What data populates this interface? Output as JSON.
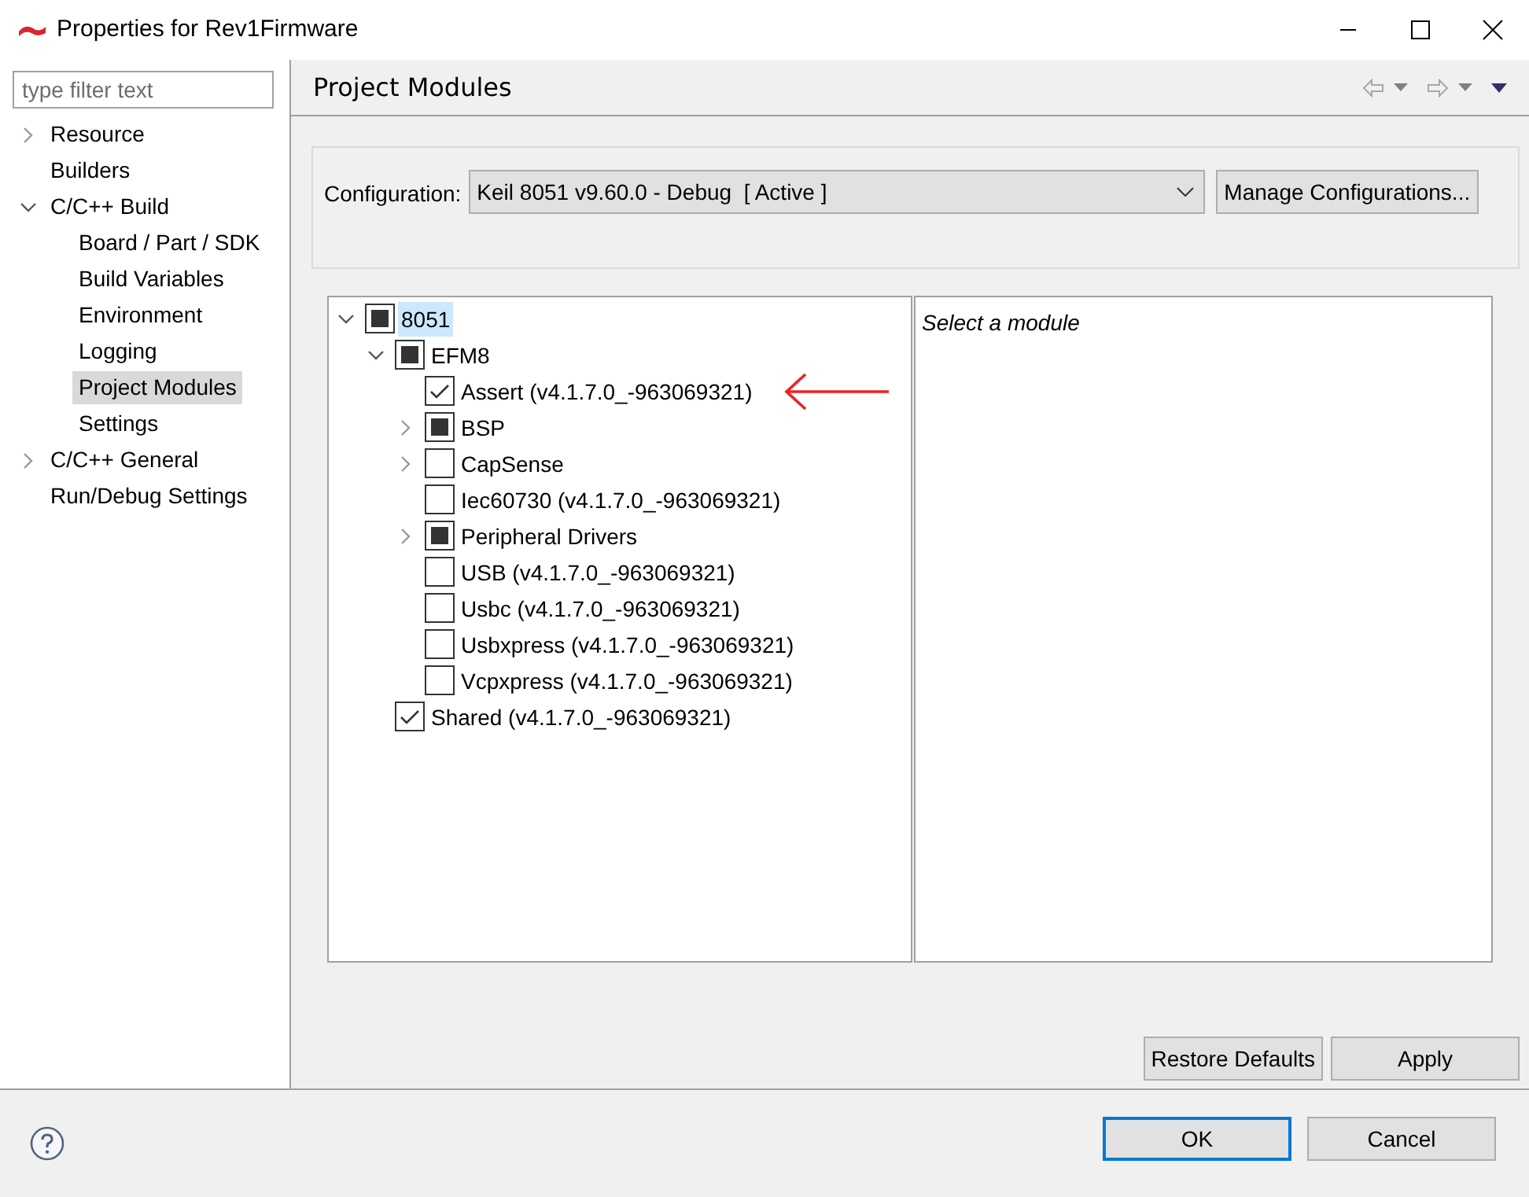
{
  "window": {
    "title": "Properties for Rev1Firmware"
  },
  "filter": {
    "placeholder": "type filter text"
  },
  "sidebar": {
    "items": [
      {
        "label": "Resource",
        "expanded": false,
        "selected": false
      },
      {
        "label": "Builders",
        "selected": false
      },
      {
        "label": "C/C++ Build",
        "expanded": true,
        "selected": false,
        "children": [
          {
            "label": "Board / Part / SDK",
            "selected": false
          },
          {
            "label": "Build Variables",
            "selected": false
          },
          {
            "label": "Environment",
            "selected": false
          },
          {
            "label": "Logging",
            "selected": false
          },
          {
            "label": "Project Modules",
            "selected": true
          },
          {
            "label": "Settings",
            "selected": false
          }
        ]
      },
      {
        "label": "C/C++ General",
        "expanded": false,
        "selected": false
      },
      {
        "label": "Run/Debug Settings",
        "selected": false
      }
    ]
  },
  "page": {
    "title": "Project Modules",
    "configuration": {
      "label": "Configuration:",
      "value": "Keil 8051 v9.60.0 - Debug  [ Active ]",
      "button": "Manage Configurations..."
    },
    "tree": [
      {
        "label": "8051",
        "checked": false,
        "indeterminate": true,
        "expanded": true,
        "selected": true,
        "children": [
          {
            "label": "EFM8",
            "checked": false,
            "indeterminate": true,
            "expanded": true,
            "selected": false,
            "children": [
              {
                "label": "Assert (v4.1.7.0_-963069321)",
                "checked": true,
                "indeterminate": false,
                "selected": false,
                "pointer": true
              },
              {
                "label": "BSP",
                "checked": false,
                "indeterminate": true,
                "expanded": false,
                "selected": false
              },
              {
                "label": "CapSense",
                "checked": false,
                "indeterminate": false,
                "expanded": false,
                "selected": false
              },
              {
                "label": "Iec60730 (v4.1.7.0_-963069321)",
                "checked": false,
                "indeterminate": false,
                "selected": false
              },
              {
                "label": "Peripheral Drivers",
                "checked": false,
                "indeterminate": true,
                "expanded": false,
                "selected": false
              },
              {
                "label": "USB (v4.1.7.0_-963069321)",
                "checked": false,
                "indeterminate": false,
                "selected": false
              },
              {
                "label": "Usbc (v4.1.7.0_-963069321)",
                "checked": false,
                "indeterminate": false,
                "selected": false
              },
              {
                "label": "Usbxpress (v4.1.7.0_-963069321)",
                "checked": false,
                "indeterminate": false,
                "selected": false
              },
              {
                "label": "Vcpxpress (v4.1.7.0_-963069321)",
                "checked": false,
                "indeterminate": false,
                "selected": false
              }
            ]
          },
          {
            "label": "Shared (v4.1.7.0_-963069321)",
            "checked": true,
            "indeterminate": false,
            "selected": false
          }
        ]
      }
    ],
    "description": "Select a module",
    "buttons": [
      "Restore Defaults",
      "Apply"
    ]
  },
  "dialog_buttons": [
    {
      "label": "OK",
      "default": true
    },
    {
      "label": "Cancel",
      "default": false
    }
  ]
}
